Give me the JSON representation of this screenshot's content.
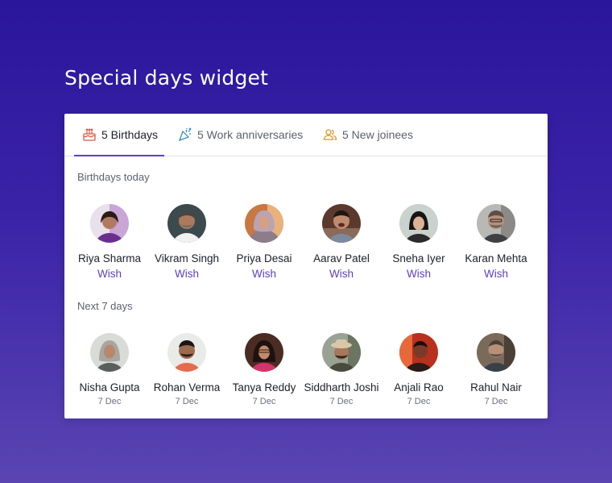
{
  "title": "Special days widget",
  "tabs": [
    {
      "label": "5 Birthdays",
      "icon": "cake-icon"
    },
    {
      "label": "5 Work anniversaries",
      "icon": "party-popper-icon"
    },
    {
      "label": "5 New joinees",
      "icon": "users-icon"
    }
  ],
  "accent_color": "#5b3fc2",
  "today": {
    "label": "Birthdays today",
    "wish_label": "Wish",
    "people": [
      {
        "name": "Riya Sharma"
      },
      {
        "name": "Vikram Singh"
      },
      {
        "name": "Priya Desai"
      },
      {
        "name": "Aarav Patel"
      },
      {
        "name": "Sneha Iyer"
      },
      {
        "name": "Karan Mehta"
      }
    ]
  },
  "upcoming": {
    "label": "Next 7 days",
    "people": [
      {
        "name": "Nisha Gupta",
        "date": "7 Dec"
      },
      {
        "name": "Rohan Verma",
        "date": "7 Dec"
      },
      {
        "name": "Tanya Reddy",
        "date": "7 Dec"
      },
      {
        "name": "Siddharth Joshi",
        "date": "7 Dec"
      },
      {
        "name": "Anjali Rao",
        "date": "7 Dec"
      },
      {
        "name": "Rahul Nair",
        "date": "7 Dec"
      }
    ]
  }
}
